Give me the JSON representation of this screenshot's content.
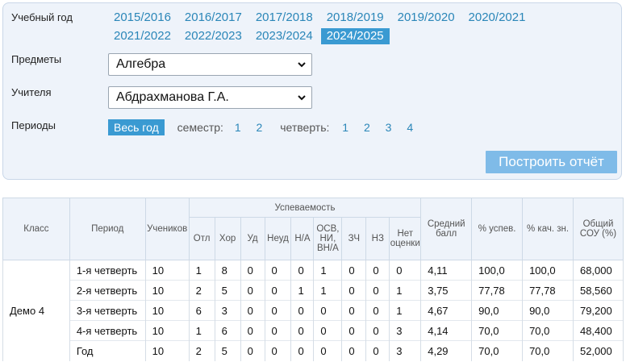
{
  "filters": {
    "year_label": "Учебный год",
    "years": [
      "2015/2016",
      "2016/2017",
      "2017/2018",
      "2018/2019",
      "2019/2020",
      "2020/2021",
      "2021/2022",
      "2022/2023",
      "2023/2024",
      "2024/2025"
    ],
    "active_year": "2024/2025",
    "subjects_label": "Предметы",
    "subject_value": "Алгебра",
    "teachers_label": "Учителя",
    "teacher_value": "Абдрахманова Г.А.",
    "periods_label": "Периоды",
    "whole_year": "Весь год",
    "semester_label": "семестр:",
    "semesters": [
      "1",
      "2"
    ],
    "quarter_label": "четверть:",
    "quarters": [
      "1",
      "2",
      "3",
      "4"
    ],
    "build_button": "Построить отчёт"
  },
  "table": {
    "headers": {
      "class": "Класс",
      "period": "Период",
      "students": "Учеников",
      "performance": "Успеваемость",
      "grades": [
        "Отл",
        "Хор",
        "Уд",
        "Неуд",
        "Н/А",
        "ОСВ, НИ, ВН/А",
        "ЗЧ",
        "НЗ",
        "Нет оценки"
      ],
      "avg": "Средний балл",
      "pct_success": "% успев.",
      "pct_quality": "% кач. зн.",
      "sou": "Общий СОУ (%)"
    },
    "class_name": "Демо 4",
    "rows": [
      {
        "period": "1-я четверть",
        "students": "10",
        "grades": [
          "1",
          "8",
          "0",
          "0",
          "0",
          "1",
          "0",
          "0",
          "0"
        ],
        "avg": "4,11",
        "success": "100,0",
        "quality": "100,0",
        "sou": "68,000"
      },
      {
        "period": "2-я четверть",
        "students": "10",
        "grades": [
          "2",
          "5",
          "0",
          "0",
          "1",
          "1",
          "0",
          "0",
          "1"
        ],
        "avg": "3,75",
        "success": "77,78",
        "quality": "77,78",
        "sou": "58,560"
      },
      {
        "period": "3-я четверть",
        "students": "10",
        "grades": [
          "6",
          "3",
          "0",
          "0",
          "0",
          "0",
          "0",
          "0",
          "1"
        ],
        "avg": "4,67",
        "success": "90,0",
        "quality": "90,0",
        "sou": "79,200"
      },
      {
        "period": "4-я четверть",
        "students": "10",
        "grades": [
          "1",
          "6",
          "0",
          "0",
          "0",
          "0",
          "0",
          "0",
          "3"
        ],
        "avg": "4,14",
        "success": "70,0",
        "quality": "70,0",
        "sou": "48,400"
      },
      {
        "period": "Год",
        "students": "10",
        "grades": [
          "2",
          "5",
          "0",
          "0",
          "0",
          "0",
          "0",
          "0",
          "3"
        ],
        "avg": "4,29",
        "success": "70,0",
        "quality": "70,0",
        "sou": "52,000"
      }
    ]
  }
}
